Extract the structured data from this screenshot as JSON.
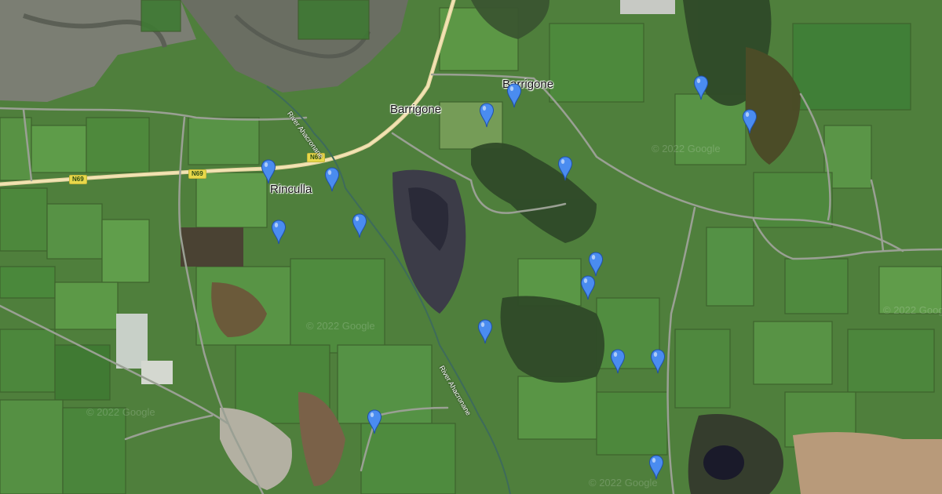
{
  "map": {
    "style": "satellite",
    "place_labels": {
      "barrigone_road": "Barrigone",
      "barrigone_village": "Barrigone",
      "rinculla": "Rinculla"
    },
    "river_labels": {
      "upper": "River Ahacronane",
      "lower": "River Ahacronane"
    },
    "road_shields": {
      "west": "N69",
      "east": "N69"
    },
    "watermark": "© 2022 Google",
    "marker_color": "#4a8cf0",
    "marker_count": 16
  }
}
